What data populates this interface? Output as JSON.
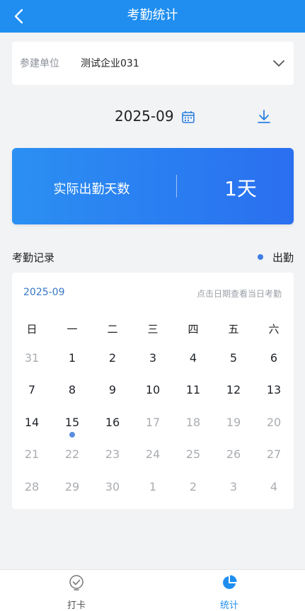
{
  "header": {
    "title": "考勤统计"
  },
  "unit": {
    "label": "参建单位",
    "value": "测试企业031"
  },
  "month": "2025-09",
  "summary": {
    "label": "实际出勤天数",
    "value": "1天"
  },
  "records": {
    "title": "考勤记录",
    "legend": "出勤"
  },
  "calendar": {
    "month": "2025-09",
    "hint": "点击日期查看当日考勤",
    "weekdays": [
      "日",
      "一",
      "二",
      "三",
      "四",
      "五",
      "六"
    ],
    "weeks": [
      [
        {
          "d": "31",
          "s": "out"
        },
        {
          "d": "1",
          "s": "in"
        },
        {
          "d": "2",
          "s": "in"
        },
        {
          "d": "3",
          "s": "in"
        },
        {
          "d": "4",
          "s": "in"
        },
        {
          "d": "5",
          "s": "in"
        },
        {
          "d": "6",
          "s": "in"
        }
      ],
      [
        {
          "d": "7",
          "s": "in"
        },
        {
          "d": "8",
          "s": "in"
        },
        {
          "d": "9",
          "s": "in"
        },
        {
          "d": "10",
          "s": "in"
        },
        {
          "d": "11",
          "s": "in"
        },
        {
          "d": "12",
          "s": "in"
        },
        {
          "d": "13",
          "s": "in"
        }
      ],
      [
        {
          "d": "14",
          "s": "in"
        },
        {
          "d": "15",
          "s": "in",
          "attended": true
        },
        {
          "d": "16",
          "s": "in"
        },
        {
          "d": "17",
          "s": "future"
        },
        {
          "d": "18",
          "s": "future"
        },
        {
          "d": "19",
          "s": "future"
        },
        {
          "d": "20",
          "s": "future"
        }
      ],
      [
        {
          "d": "21",
          "s": "future"
        },
        {
          "d": "22",
          "s": "future"
        },
        {
          "d": "23",
          "s": "future"
        },
        {
          "d": "24",
          "s": "future"
        },
        {
          "d": "25",
          "s": "future"
        },
        {
          "d": "26",
          "s": "future"
        },
        {
          "d": "27",
          "s": "future"
        }
      ],
      [
        {
          "d": "28",
          "s": "future"
        },
        {
          "d": "29",
          "s": "future"
        },
        {
          "d": "30",
          "s": "future"
        },
        {
          "d": "1",
          "s": "out"
        },
        {
          "d": "2",
          "s": "out"
        },
        {
          "d": "3",
          "s": "out"
        },
        {
          "d": "4",
          "s": "out"
        }
      ]
    ]
  },
  "tabs": [
    {
      "label": "打卡",
      "icon": "check-location-icon",
      "active": false
    },
    {
      "label": "统计",
      "icon": "pie-chart-icon",
      "active": true
    }
  ],
  "colors": {
    "brand": "#1f8ef0",
    "accent": "#3d7ee3",
    "active_tab": "#1f8ef0",
    "inactive_tab": "#555555"
  }
}
